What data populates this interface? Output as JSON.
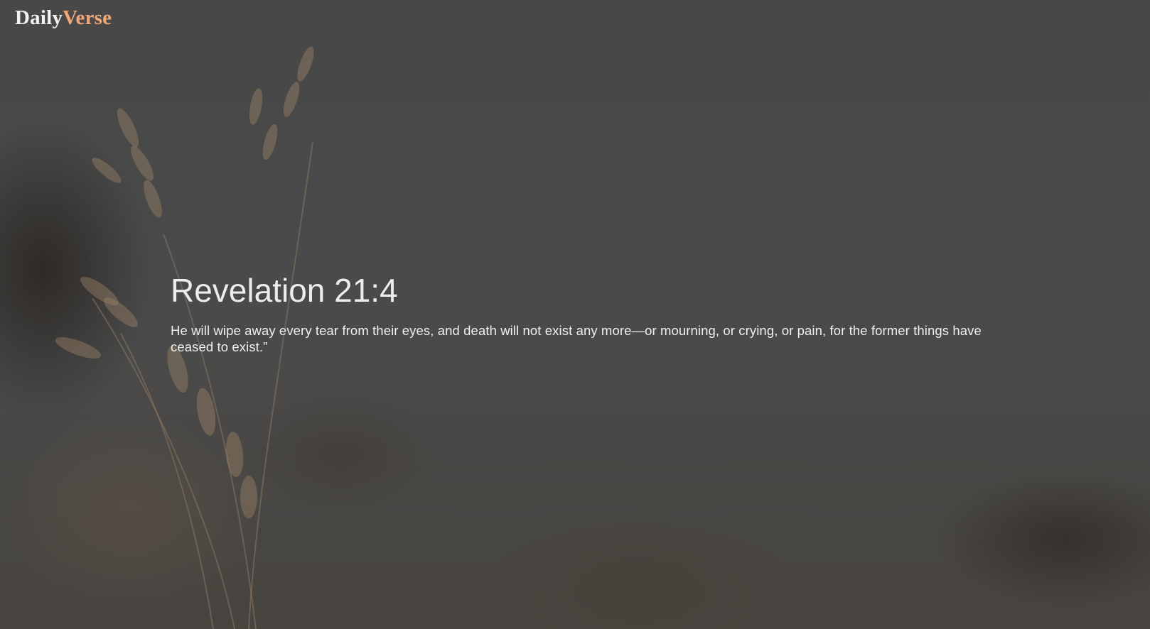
{
  "header": {
    "logo_part1": "Daily",
    "logo_part2": "Verse"
  },
  "verse": {
    "reference": "Revelation 21:4",
    "text": "He will wipe away every tear from their eyes, and death will not exist any more—or mourning, or crying, or pain, for the former things have ceased to exist.”"
  },
  "colors": {
    "overlay": "#4a4a4a",
    "logo_primary": "#f2f2f2",
    "logo_accent": "#f0a878",
    "text": "#ececec"
  },
  "background_image": "wheat-stalks-field-photo"
}
